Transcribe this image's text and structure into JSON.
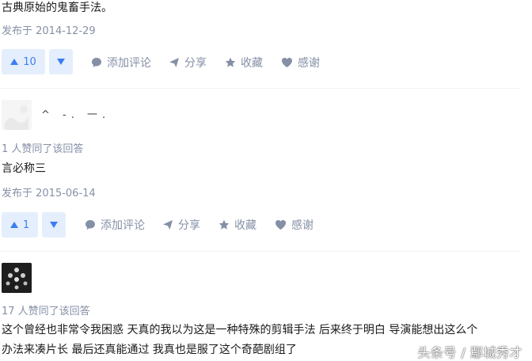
{
  "answers": [
    {
      "content_lines": [
        "古典原始的鬼畜手法。"
      ],
      "published": "发布于 2014-12-29",
      "upvotes": "10"
    },
    {
      "author": "^ -. 一.",
      "likes_line": "1 人赞同了该回答",
      "content_lines": [
        "言必称三"
      ],
      "published": "发布于 2015-06-14",
      "upvotes": "1"
    },
    {
      "likes_line": "17 人赞同了该回答",
      "content_lines": [
        "这个曾经也非常令我困惑   天真的我以为这是一种特殊的剪辑手法 后来终于明白  导演能想出这么个",
        "办法来凑片长  最后还真能通过    我真也是服了这个奇葩剧组了"
      ]
    }
  ],
  "actions": {
    "comment": "添加评论",
    "share": "分享",
    "favorite": "收藏",
    "thanks": "感谢"
  },
  "watermark": "头条号 / 鄢城秀才",
  "colors": {
    "accent": "#3a7ff2",
    "vote_bg": "#e5eefc",
    "meta": "#8590a6"
  }
}
